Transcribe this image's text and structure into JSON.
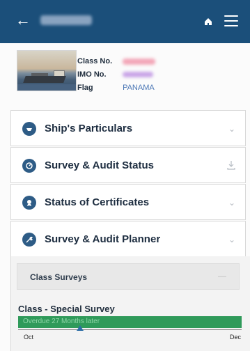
{
  "header": {
    "back_icon": "back-arrow-icon",
    "title_text": "BK ALICE",
    "home_icon": "home-icon",
    "menu_icon": "hamburger-menu-icon"
  },
  "ship": {
    "image_label": "ship-photo",
    "class_no_label": "Class No.",
    "class_no_value": "1234567",
    "imo_no_label": "IMO No.",
    "imo_no_value": "9876543",
    "flag_label": "Flag",
    "flag_value": "PANAMA"
  },
  "sections": [
    {
      "label": "Ship's Particulars",
      "icon": "ship-icon",
      "action_icon": "chevron-down-icon"
    },
    {
      "label": "Survey & Audit Status",
      "icon": "gauge-icon",
      "action_icon": "download-icon"
    },
    {
      "label": "Status of Certificates",
      "icon": "certificate-icon",
      "action_icon": "chevron-down-icon"
    },
    {
      "label": "Survey & Audit Planner",
      "icon": "wrench-icon",
      "action_icon": "chevron-down-icon"
    }
  ],
  "planner": {
    "class_surveys_label": "Class Surveys",
    "special_survey_title": "Class - Special Survey",
    "status_text": "Overdue 27 Months later",
    "timeline_start": "Oct",
    "timeline_end": "Dec"
  },
  "colors": {
    "header": "#1b4f7a",
    "accent": "#2e5c86",
    "status_bar": "#2f9a5a",
    "flag_text": "#4a76b5"
  }
}
